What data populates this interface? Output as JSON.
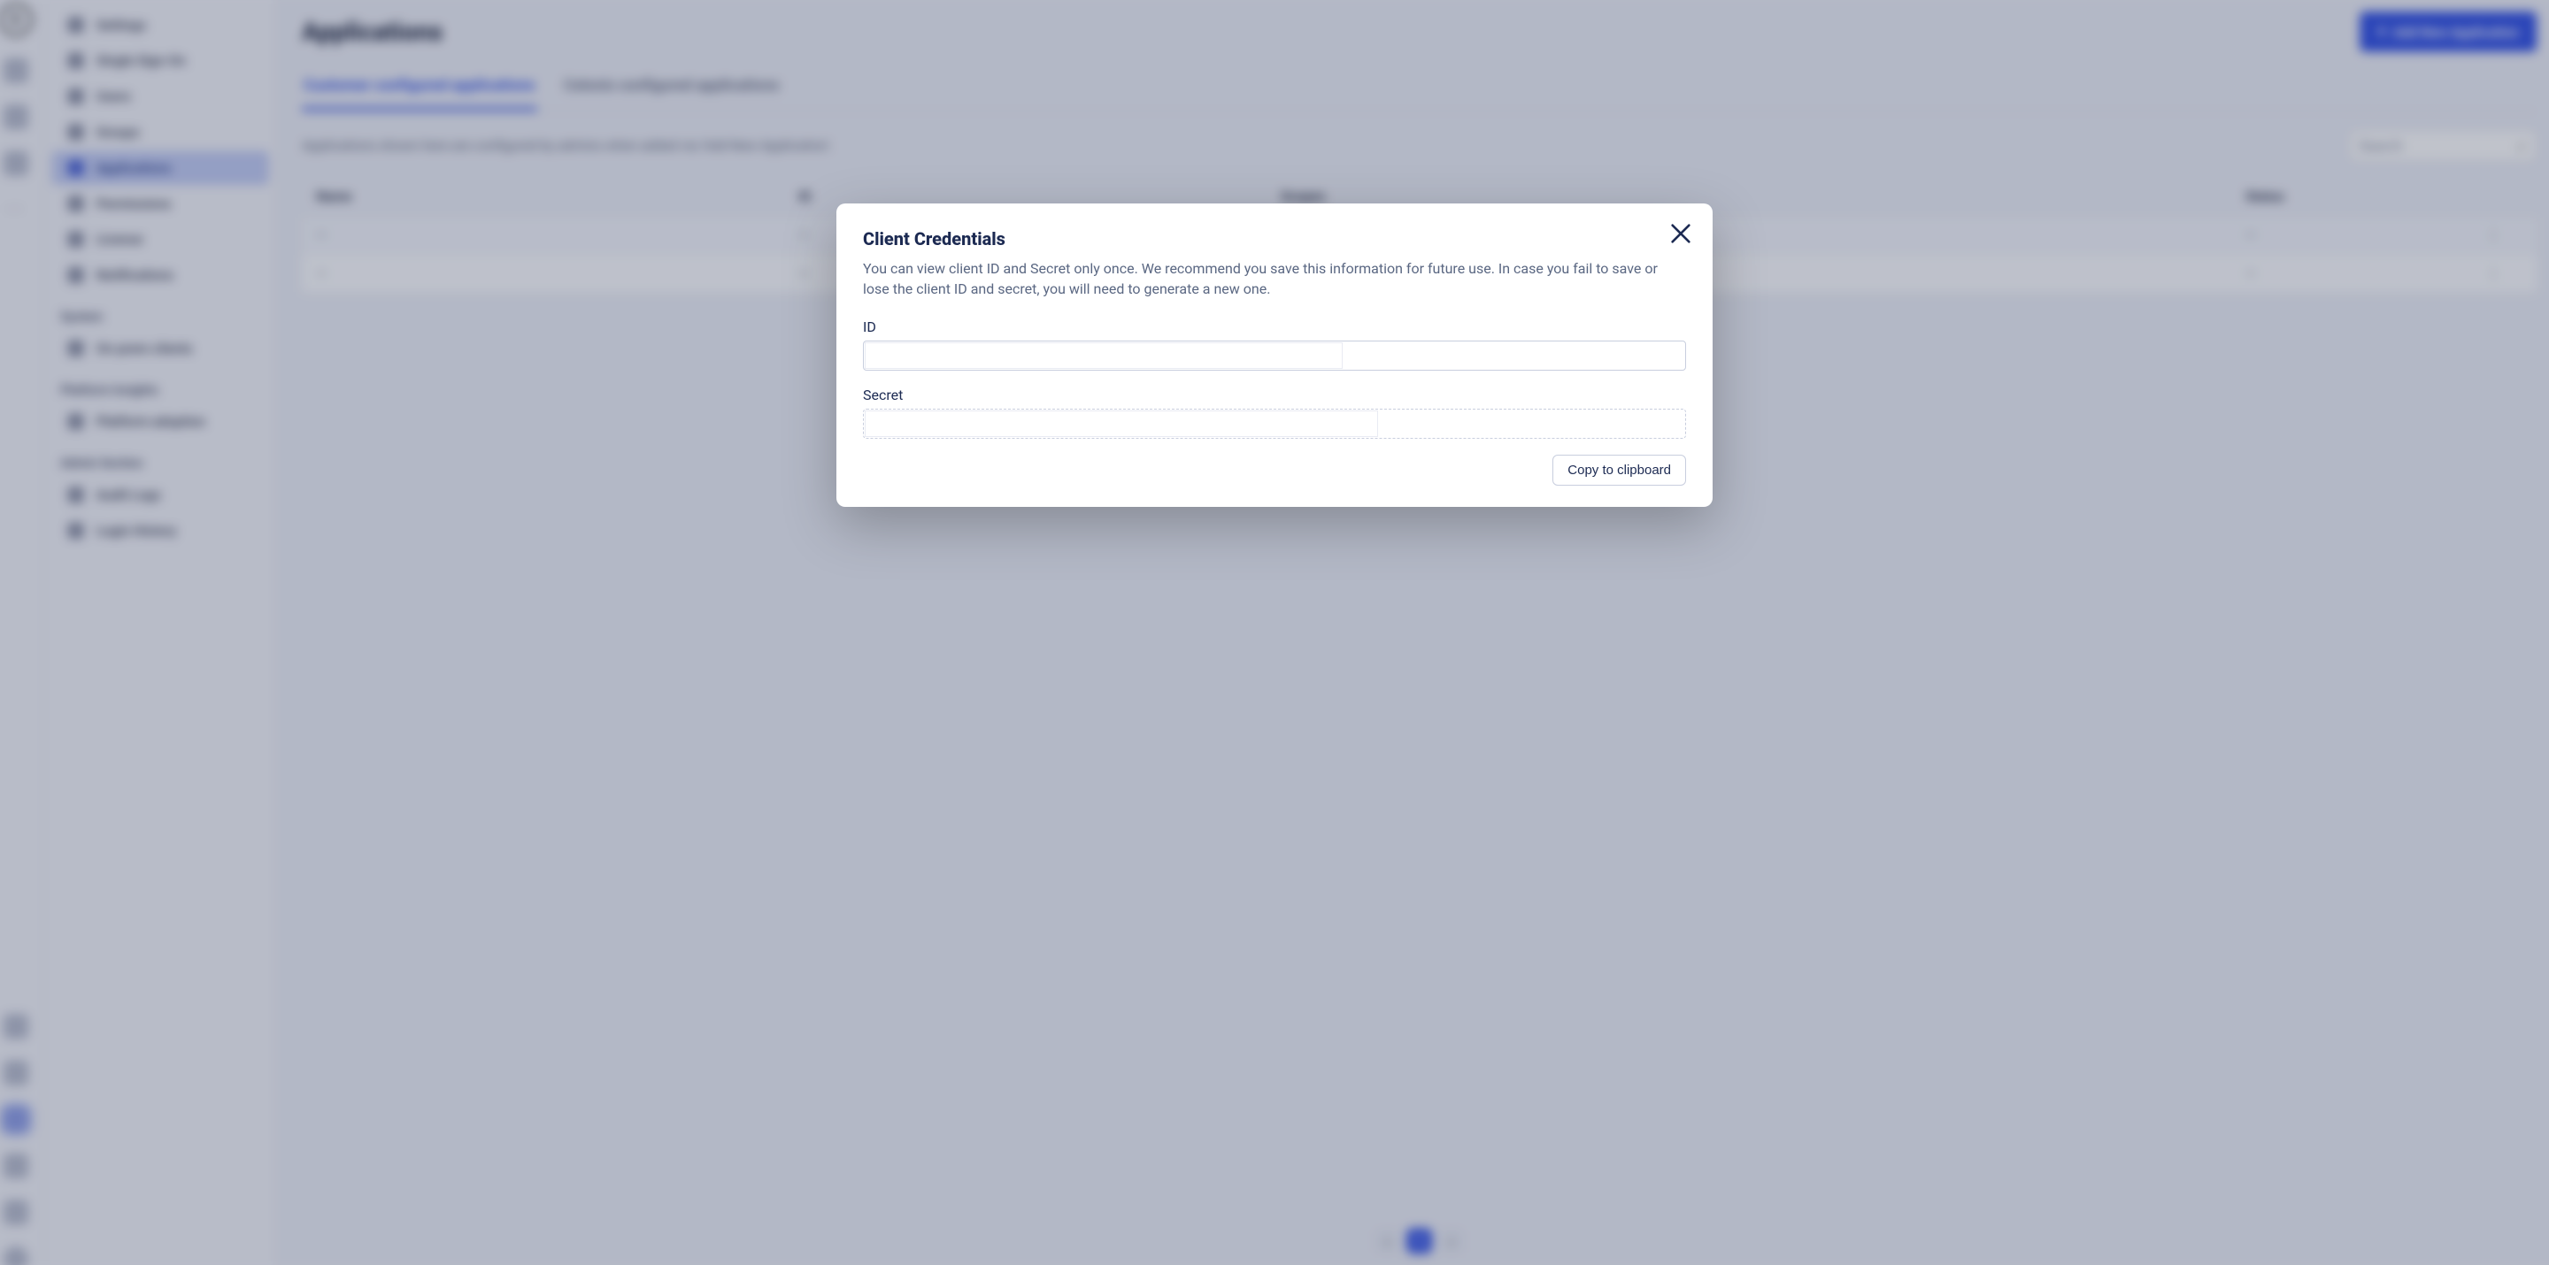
{
  "page": {
    "title": "Applications",
    "add_button": "Add New Application"
  },
  "tabs": {
    "customer": "Customer configured applications",
    "celonis": "Celonis configured applications"
  },
  "hint": "Applications shown here are configured by admins when added via 'Add New Application'.",
  "search_placeholder": "Search",
  "columns": {
    "name": "Name",
    "id": "ID",
    "scopes": "Scopes",
    "status": "Status"
  },
  "sidebar": {
    "items": [
      "Settings",
      "Single Sign-On",
      "Users",
      "Groups",
      "Applications",
      "Permissions",
      "License",
      "Notifications"
    ],
    "section_system": "System",
    "system_items": [
      "On-prem clients"
    ],
    "section_insights": "Platform Insights",
    "insights_items": [
      "Platform adoption"
    ],
    "section_admin": "Admin Section",
    "admin_items": [
      "Audit Logs",
      "Login History"
    ]
  },
  "pagination": {
    "current": "1"
  },
  "modal": {
    "title": "Client Credentials",
    "description": "You can view client ID and Secret only once. We recommend you save this information for future use. In case you fail to save or lose the client ID and secret, you will need to generate a new one.",
    "id_label": "ID",
    "secret_label": "Secret",
    "copy_button": "Copy to clipboard",
    "id_value": "",
    "secret_value": ""
  }
}
